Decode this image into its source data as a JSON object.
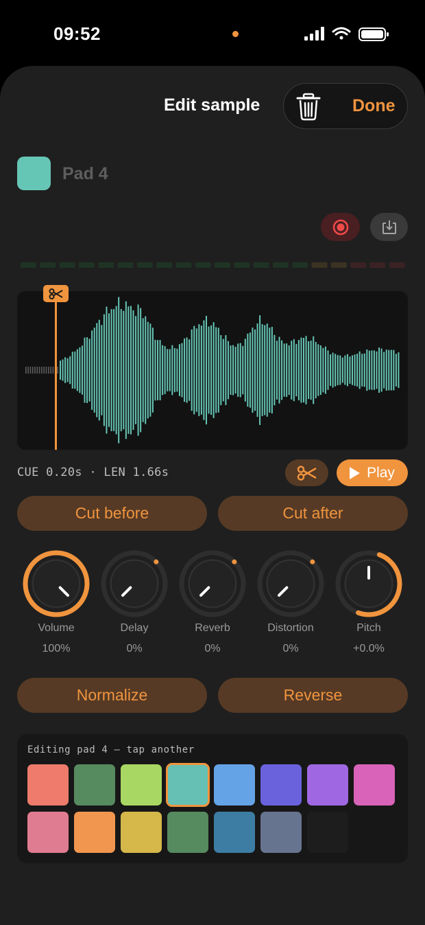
{
  "status": {
    "time": "09:52"
  },
  "header": {
    "title": "Edit sample",
    "done_label": "Done"
  },
  "pad": {
    "name": "Pad 4",
    "color": "#66c6b6"
  },
  "recorder": {
    "record_icon": "record-icon",
    "import_icon": "import-icon"
  },
  "waveform": {
    "color": "#66c6b6",
    "cue_color": "#f0943e"
  },
  "cue_readout": "CUE 0.20s · LEN 1.66s",
  "transport": {
    "play_label": "Play"
  },
  "edit_buttons": {
    "cut_before": "Cut before",
    "cut_after": "Cut after"
  },
  "knobs": [
    {
      "label": "Volume",
      "value": "100%",
      "level": 1.0,
      "active": true
    },
    {
      "label": "Delay",
      "value": "0%",
      "level": 0.0,
      "active": false
    },
    {
      "label": "Reverb",
      "value": "0%",
      "level": 0.0,
      "active": false
    },
    {
      "label": "Distortion",
      "value": "0%",
      "level": 0.0,
      "active": false
    },
    {
      "label": "Pitch",
      "value": "+0.0%",
      "level": 0.5,
      "active": true
    }
  ],
  "process_buttons": {
    "normalize": "Normalize",
    "reverse": "Reverse"
  },
  "palette": {
    "hint": "Editing pad 4 — tap another",
    "selected_index": 3,
    "colors": [
      "#ee7b6b",
      "#568a5f",
      "#a8d863",
      "#66c0b3",
      "#63a3e6",
      "#6a62dd",
      "#9f68e2",
      "#d863b8",
      "#e07c91",
      "#f0964f",
      "#d5b74a",
      "#568a5f",
      "#3d7da3",
      "#67748f",
      "#1d1d1d"
    ]
  }
}
